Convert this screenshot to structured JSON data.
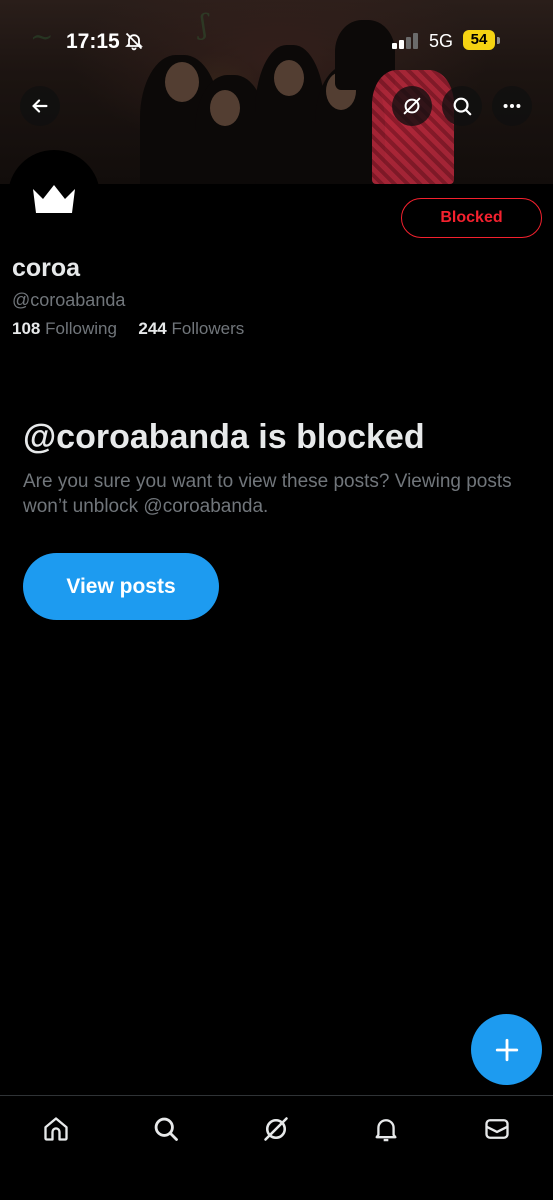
{
  "status_bar": {
    "time": "17:15",
    "network": "5G",
    "battery": "54"
  },
  "banner": {
    "back_icon": "arrow-left-icon",
    "grok_icon": "grok-icon",
    "search_icon": "search-icon",
    "more_icon": "more-horizontal-icon"
  },
  "profile": {
    "avatar_icon": "crown-icon",
    "block_status_label": "Blocked",
    "display_name": "coroa",
    "handle": "@coroabanda",
    "following_count": "108",
    "following_label": "Following",
    "followers_count": "244",
    "followers_label": "Followers"
  },
  "blocked_notice": {
    "title": "@coroabanda is blocked",
    "description": "Are you sure you want to view these posts? Viewing posts won’t unblock @coroabanda.",
    "button_label": "View posts"
  },
  "fab": {
    "icon": "plus-icon"
  },
  "bottom_nav": {
    "items": [
      {
        "icon": "home-icon"
      },
      {
        "icon": "search-icon"
      },
      {
        "icon": "grok-icon"
      },
      {
        "icon": "bell-icon"
      },
      {
        "icon": "mail-icon"
      }
    ]
  },
  "colors": {
    "accent": "#1d9bf0",
    "blocked_red": "#f4212e",
    "secondary_text": "#71767b",
    "battery": "#f5d312"
  }
}
